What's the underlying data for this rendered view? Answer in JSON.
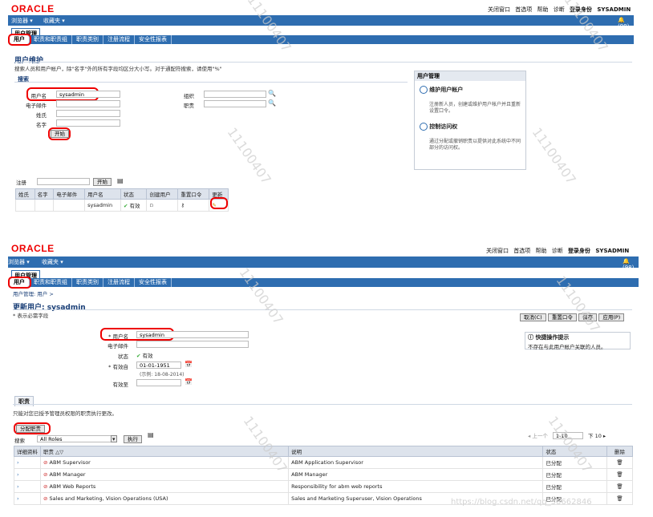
{
  "brand": "ORACLE",
  "top_links": [
    "关闭窗口",
    "首选项",
    "帮助",
    "诊断",
    "注销",
    "登录身份 SYSADMIN"
  ],
  "nav": {
    "browser": "浏览器",
    "favorites": "收藏夹",
    "notif1": "(98)",
    "notif2": "(98)"
  },
  "app_tab": "用户管理",
  "subtabs": [
    "用户",
    "职责和职责组",
    "职责类别",
    "注册流程",
    "安全性报表"
  ],
  "top": {
    "title": "用户维护",
    "hint": "搜索人员和用户帐户，除\"名字\"外的所有字段均区分大小写。对于通配符搜索，请使用\"%\"",
    "search_label": "搜索",
    "fields": [
      {
        "label": "用户名",
        "value": "sysadmin"
      },
      {
        "label": "电子邮件",
        "value": ""
      },
      {
        "label": "姓氏",
        "value": ""
      },
      {
        "label": "名字",
        "value": ""
      }
    ],
    "right_fields": [
      {
        "label": "组织",
        "value": ""
      },
      {
        "label": "职责",
        "value": ""
      }
    ],
    "go": "开始",
    "panel": {
      "title": "用户管理",
      "items": [
        {
          "title": "维护用户帐户",
          "desc": "注册新人员，创建或维护用户帐户并且重新设置口令。"
        },
        {
          "title": "控制访问权",
          "desc": "通过分配或撤销职责以提供对此系统中不同部分的访问权。"
        }
      ]
    },
    "register_label": "注册",
    "go2": "开始",
    "cols": [
      "姓氏",
      "名字",
      "电子邮件",
      "用户名",
      "状态",
      "创建用户",
      "重置口令",
      "更新"
    ],
    "row": {
      "user": "sysadmin",
      "status": "有效"
    }
  },
  "bottom": {
    "breadcrumb": "用户管理: 用户 >",
    "title": "更新用户: sysadmin",
    "required": "* 表示必需字段",
    "buttons": [
      "取消(C)",
      "重置口令",
      "保存",
      "应用(P)"
    ],
    "username_label": "用户名",
    "username": "sysadmin",
    "email_label": "电子邮件",
    "status_label": "状态",
    "status": "有效",
    "from_label": "有效自",
    "from": "01-01-1951",
    "example": "(示例: 18-08-2014)",
    "to_label": "有效至",
    "tip_title": "快捷操作提示",
    "tip": "不存在与此用户帐户关联的人员。",
    "section_tab": "职责",
    "section_hint": "只能对您已授予管理员权限的职责执行更改。",
    "assign": "分配职责",
    "search_label": "搜索",
    "search_value": "All Roles",
    "run": "执行",
    "pager": {
      "prev": "上一个",
      "range": "1-10",
      "next": "下 10"
    },
    "cols": [
      "详细资料",
      "职责",
      "说明",
      "状态",
      "删除"
    ],
    "rows": [
      {
        "name": "ABM Supervisor",
        "desc": "ABM Application Supervisor",
        "status": "已分配"
      },
      {
        "name": "ABM Manager",
        "desc": "ABM Manager",
        "status": "已分配"
      },
      {
        "name": "ABM Web Reports",
        "desc": "Responsibility for abm web reports",
        "status": "已分配"
      },
      {
        "name": "Sales and Marketing, Vision Operations (USA)",
        "desc": "Sales and Marketing Superuser, Vision Operations",
        "status": "已分配"
      }
    ]
  },
  "watermark": "11100407",
  "footer_url": "https://blog.csdn.net/qq_38662846"
}
